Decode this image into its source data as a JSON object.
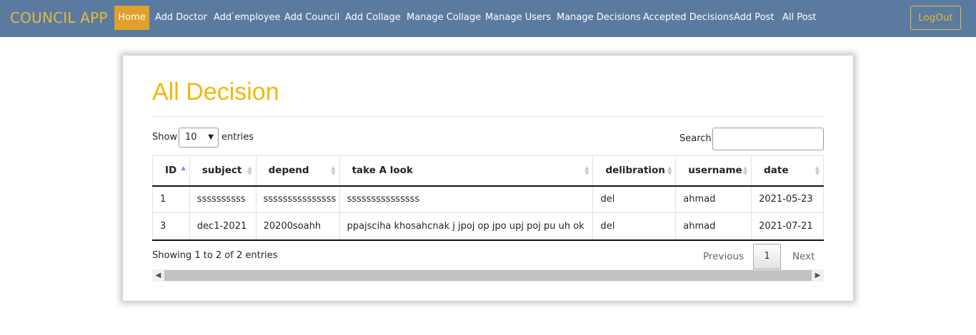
{
  "nav": {
    "brand": "COUNCIL APP",
    "items": [
      "Home",
      "Add Doctor",
      "Add ́employee",
      "Add Council",
      "Add Collage",
      "Manage Collage",
      "Manage Users",
      "Manage Decisions",
      "Accepted Decisions",
      "Add Post",
      "All Post"
    ],
    "logout": "LogOut"
  },
  "page": {
    "title": "All Decision",
    "show_label": "Show",
    "length_value": "10",
    "entries_label": "entries",
    "search_label": "Search:",
    "search_value": ""
  },
  "table": {
    "columns": [
      "ID",
      "subject",
      "depend",
      "take A look",
      "delibration",
      "username",
      "date"
    ],
    "rows": [
      [
        "1",
        "ssssssssss",
        "sssssssssssssss",
        "sssssssssssssss",
        "del",
        "ahmad",
        "2021-05-23"
      ],
      [
        "3",
        "dec1-2021",
        "20200soahh",
        "ppajsciha khosahcnak j jpoj op jpo upj poj pu uh ok",
        "del",
        "ahmad",
        "2021-07-21"
      ]
    ]
  },
  "footer": {
    "info": "Showing 1 to 2 of 2 entries",
    "previous": "Previous",
    "page": "1",
    "next": "Next"
  },
  "colors": {
    "navbar": "#5b7aa0",
    "brand": "#e8b83a",
    "active": "#e0a02a",
    "title": "#f2b705"
  }
}
